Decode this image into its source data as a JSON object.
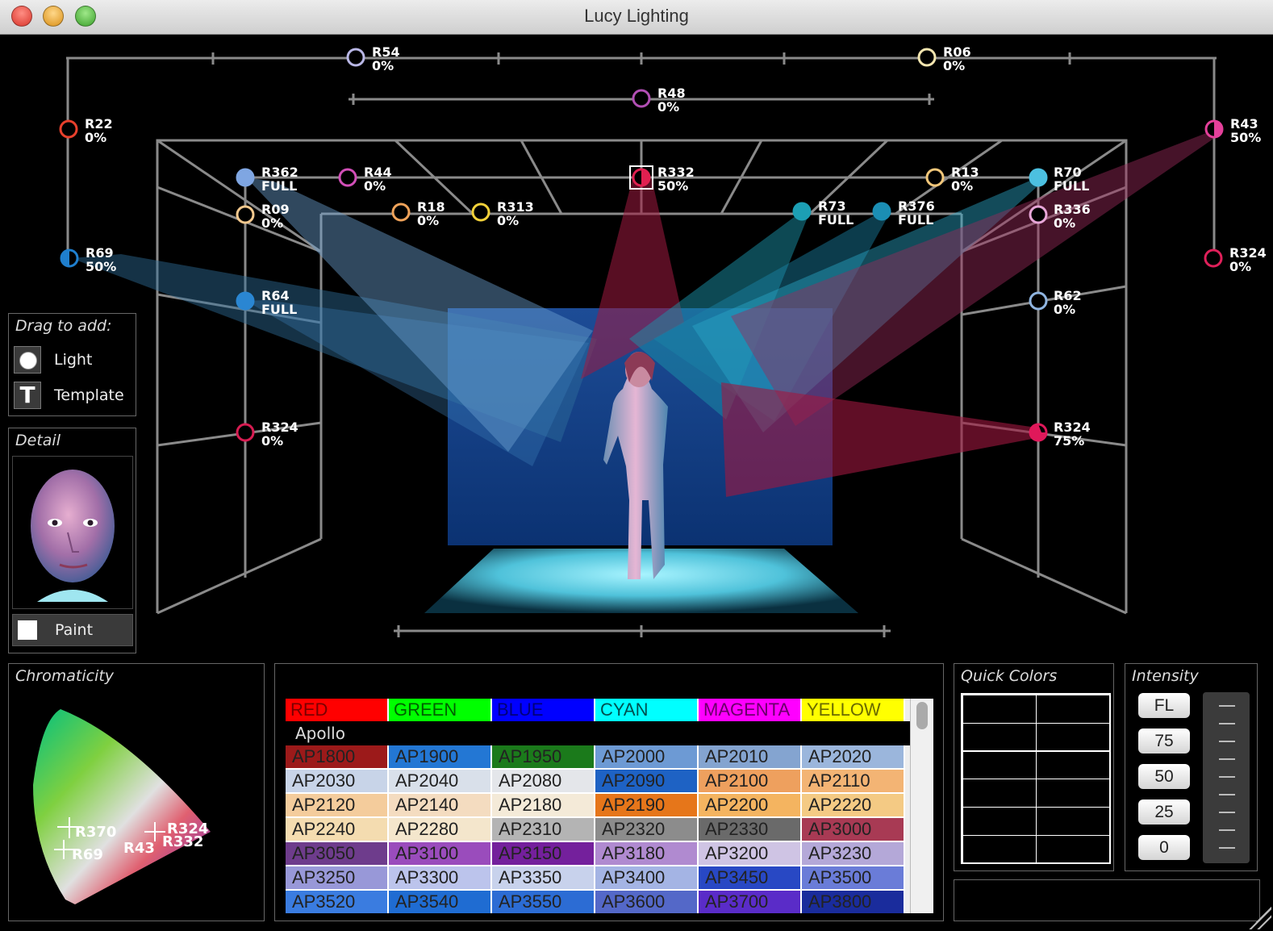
{
  "window": {
    "title": "Lucy Lighting"
  },
  "lights": [
    {
      "id": "R54",
      "level": "0%",
      "color": "#b9b7e6"
    },
    {
      "id": "R06",
      "level": "0%",
      "color": "#f4e6b0"
    },
    {
      "id": "R48",
      "level": "0%",
      "color": "#b24fb4"
    },
    {
      "id": "R22",
      "level": "0%",
      "color": "#e8402c"
    },
    {
      "id": "R43",
      "level": "50%",
      "color": "#e4409a"
    },
    {
      "id": "R362",
      "level": "FULL",
      "color": "#7fa6e2"
    },
    {
      "id": "R44",
      "level": "0%",
      "color": "#d24fb8"
    },
    {
      "id": "R332",
      "level": "50%",
      "color": "#e02050"
    },
    {
      "id": "R13",
      "level": "0%",
      "color": "#f2c77a"
    },
    {
      "id": "R70",
      "level": "FULL",
      "color": "#4cc0e0"
    },
    {
      "id": "R09",
      "level": "0%",
      "color": "#f4c98e"
    },
    {
      "id": "R18",
      "level": "0%",
      "color": "#f0a35a"
    },
    {
      "id": "R313",
      "level": "0%",
      "color": "#f3d23a"
    },
    {
      "id": "R73",
      "level": "FULL",
      "color": "#1c9fb4"
    },
    {
      "id": "R376",
      "level": "FULL",
      "color": "#1b8eb4"
    },
    {
      "id": "R336",
      "level": "0%",
      "color": "#e8a6d8"
    },
    {
      "id": "R69",
      "level": "50%",
      "color": "#1f7fce"
    },
    {
      "id": "R324",
      "level": "0%",
      "color": "#e0205a"
    },
    {
      "id": "R64",
      "level": "FULL",
      "color": "#2a86d2"
    },
    {
      "id": "R62",
      "level": "0%",
      "color": "#8fb4e0"
    },
    {
      "id": "R324",
      "level": "0%",
      "color": "#d81c52"
    },
    {
      "id": "R324",
      "level": "75%",
      "color": "#e0185a"
    }
  ],
  "drag_panel": {
    "title": "Drag to add:",
    "items": [
      {
        "label": "Light",
        "icon": "light-icon"
      },
      {
        "label": "Template",
        "icon": "template-icon"
      }
    ]
  },
  "detail_panel": {
    "title": "Detail",
    "paint_label": "Paint"
  },
  "chromaticity": {
    "title": "Chromaticity",
    "markers": [
      "R370",
      "R324",
      "R332",
      "R69",
      "R43"
    ]
  },
  "color_table": {
    "headers": [
      {
        "label": "RED",
        "bg": "#ff0000",
        "fg": "#7a0000"
      },
      {
        "label": "GREEN",
        "bg": "#00ff00",
        "fg": "#006000"
      },
      {
        "label": "BLUE",
        "bg": "#0000ff",
        "fg": "#00007a"
      },
      {
        "label": "CYAN",
        "bg": "#00ffff",
        "fg": "#005050"
      },
      {
        "label": "MAGENTA",
        "bg": "#ff00ff",
        "fg": "#6a006a"
      },
      {
        "label": "YELLOW",
        "bg": "#ffff00",
        "fg": "#6a6a00"
      }
    ],
    "manufacturer": "Apollo",
    "rows": [
      [
        {
          "code": "AP1800",
          "bg": "#9c1a1a"
        },
        {
          "code": "AP1900",
          "bg": "#2377d4"
        },
        {
          "code": "AP1950",
          "bg": "#1b7a1b"
        },
        {
          "code": "AP2000",
          "bg": "#6d9ad4"
        },
        {
          "code": "AP2010",
          "bg": "#84a4d0"
        },
        {
          "code": "AP2020",
          "bg": "#9bb6dc"
        }
      ],
      [
        {
          "code": "AP2030",
          "bg": "#c8d4e8"
        },
        {
          "code": "AP2040",
          "bg": "#d9e0ea"
        },
        {
          "code": "AP2080",
          "bg": "#e4e6ea"
        },
        {
          "code": "AP2090",
          "bg": "#1e62c4"
        },
        {
          "code": "AP2100",
          "bg": "#eea05e"
        },
        {
          "code": "AP2110",
          "bg": "#f3b474"
        }
      ],
      [
        {
          "code": "AP2120",
          "bg": "#f4cc9c"
        },
        {
          "code": "AP2140",
          "bg": "#f4dcc0"
        },
        {
          "code": "AP2180",
          "bg": "#f4ead8"
        },
        {
          "code": "AP2190",
          "bg": "#e6761a"
        },
        {
          "code": "AP2200",
          "bg": "#f4b460"
        },
        {
          "code": "AP2220",
          "bg": "#f4ca84"
        }
      ],
      [
        {
          "code": "AP2240",
          "bg": "#f4dcb0"
        },
        {
          "code": "AP2280",
          "bg": "#f4e6cc"
        },
        {
          "code": "AP2310",
          "bg": "#b4b4b4"
        },
        {
          "code": "AP2320",
          "bg": "#8c8c8c"
        },
        {
          "code": "AP2330",
          "bg": "#6a6a6a"
        },
        {
          "code": "AP3000",
          "bg": "#a83a54"
        }
      ],
      [
        {
          "code": "AP3050",
          "bg": "#6e3c8c"
        },
        {
          "code": "AP3100",
          "bg": "#9a4cbc"
        },
        {
          "code": "AP3150",
          "bg": "#74209c"
        },
        {
          "code": "AP3180",
          "bg": "#b08ad0"
        },
        {
          "code": "AP3200",
          "bg": "#cfc4e4"
        },
        {
          "code": "AP3230",
          "bg": "#b4a8d8"
        }
      ],
      [
        {
          "code": "AP3250",
          "bg": "#9898d8"
        },
        {
          "code": "AP3300",
          "bg": "#bcc4ec"
        },
        {
          "code": "AP3350",
          "bg": "#c8d2ec"
        },
        {
          "code": "AP3400",
          "bg": "#a4b4e4"
        },
        {
          "code": "AP3450",
          "bg": "#2848c4"
        },
        {
          "code": "AP3500",
          "bg": "#6a7cd8"
        }
      ],
      [
        {
          "code": "AP3520",
          "bg": "#3a7ce0"
        },
        {
          "code": "AP3540",
          "bg": "#1f6cd2"
        },
        {
          "code": "AP3550",
          "bg": "#2c6cd4"
        },
        {
          "code": "AP3600",
          "bg": "#5468c8"
        },
        {
          "code": "AP3700",
          "bg": "#5a2cc8"
        },
        {
          "code": "AP3800",
          "bg": "#1a2c9c"
        }
      ]
    ]
  },
  "quick_colors": {
    "title": "Quick Colors"
  },
  "intensity": {
    "title": "Intensity",
    "buttons": [
      "FL",
      "75",
      "50",
      "25",
      "0"
    ]
  }
}
